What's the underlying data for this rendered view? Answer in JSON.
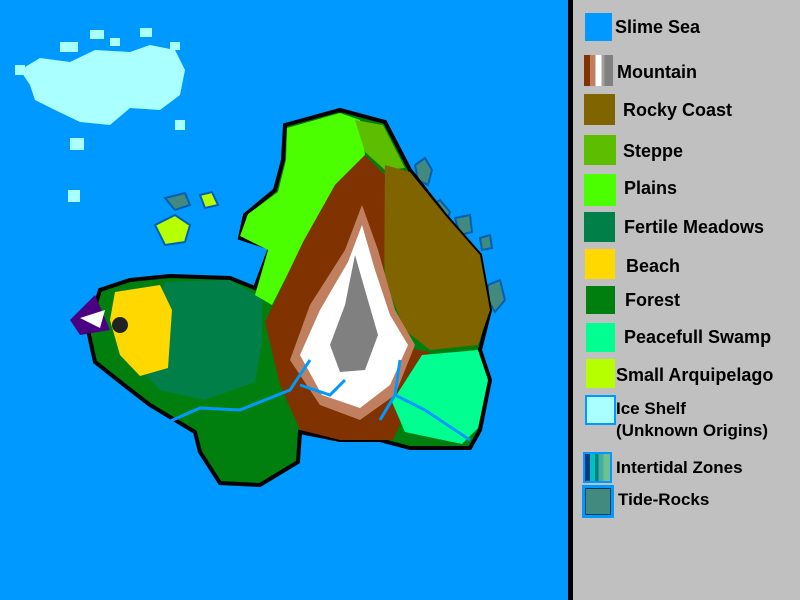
{
  "colors": {
    "sea": "#0099ff",
    "panel": "#c0c0c0",
    "divider": "#000000",
    "forest": "#007f0e",
    "meadows": "#008048",
    "plains": "#4cff00",
    "steppe": "#5dbd00",
    "rocky_coast": "#7f6400",
    "mountain_brown": "#803300",
    "mountain_tan": "#c08060",
    "mountain_white": "#ffffff",
    "mountain_gray": "#808080",
    "beach": "#ffd800",
    "swamp": "#00ff90",
    "arquipelago": "#b6ff00",
    "ice_shelf": "#aaffff",
    "tide_rocks": "#428a80",
    "intertidal": "#0070c0"
  },
  "legend": [
    {
      "label": "Slime Sea",
      "swatch": "slime-sea"
    },
    {
      "label": "Mountain",
      "swatch": "mountain"
    },
    {
      "label": "Rocky Coast",
      "swatch": "rocky-coast"
    },
    {
      "label": "Steppe",
      "swatch": "steppe"
    },
    {
      "label": "Plains",
      "swatch": "plains"
    },
    {
      "label": "Fertile Meadows",
      "swatch": "fertile-meadows"
    },
    {
      "label": "Beach",
      "swatch": "beach"
    },
    {
      "label": "Forest",
      "swatch": "forest"
    },
    {
      "label": "Peacefull Swamp",
      "swatch": "peacefull-swamp"
    },
    {
      "label": "Small Arquipelago",
      "swatch": "small-arquipelago"
    },
    {
      "label": "Ice Shelf",
      "label2": "(Unknown Origins)",
      "swatch": "ice-shelf"
    },
    {
      "label": "Intertidal Zones",
      "swatch": "intertidal-zones"
    },
    {
      "label": "Tide-Rocks",
      "swatch": "tide-rocks"
    }
  ]
}
